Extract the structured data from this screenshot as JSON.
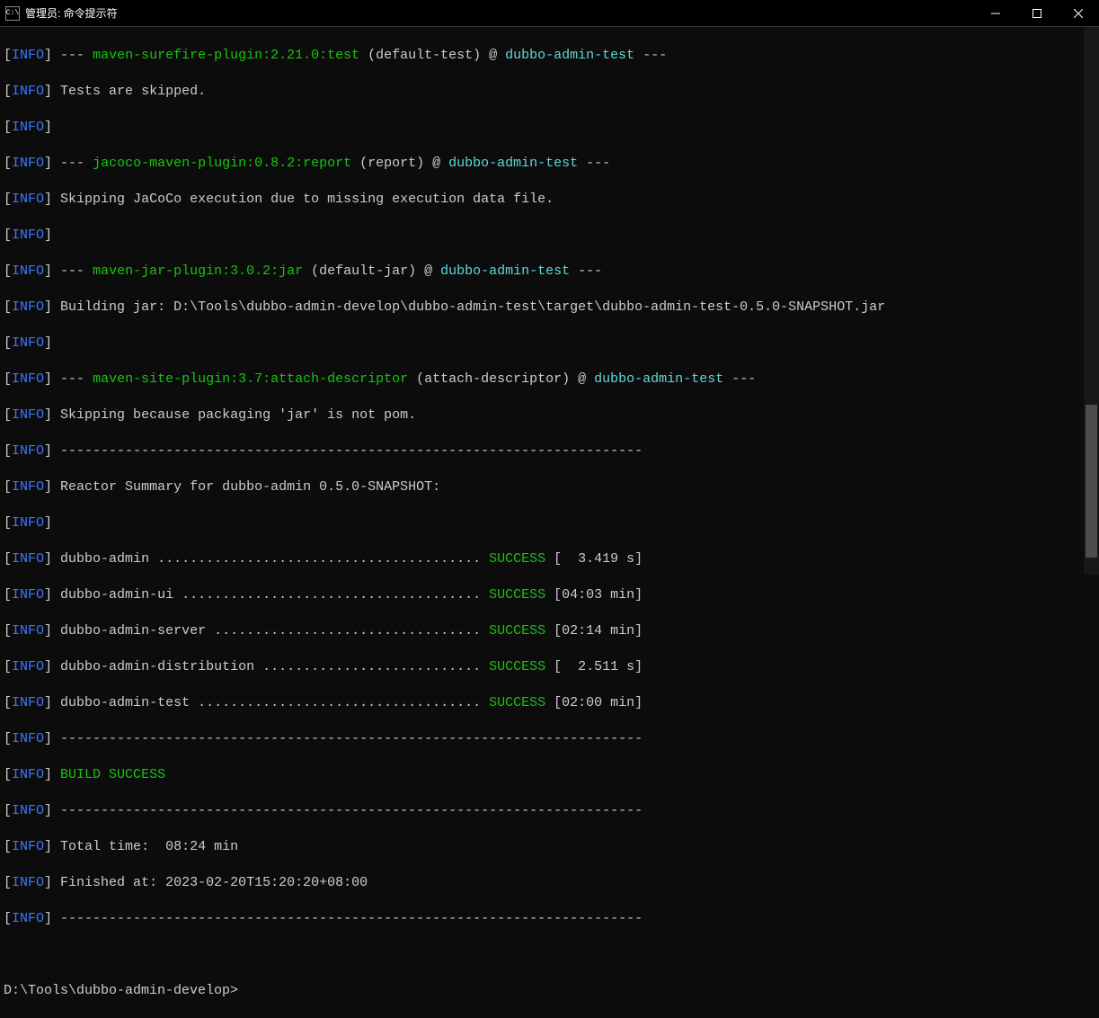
{
  "window": {
    "icon_text": "C:\\",
    "title": "管理员: 命令提示符"
  },
  "tag": {
    "bracket_open": "[",
    "bracket_close": "]",
    "info": "INFO"
  },
  "lines": {
    "l1": {
      "seg1": " --- ",
      "seg2": "maven-surefire-plugin:2.21.0:test",
      "seg3": " (default-test) @ ",
      "seg4": "dubbo-admin-test",
      "seg5": " ---"
    },
    "l2": " Tests are skipped.",
    "l3": "",
    "l4": {
      "seg1": " --- ",
      "seg2": "jacoco-maven-plugin:0.8.2:report",
      "seg3": " (report) @ ",
      "seg4": "dubbo-admin-test",
      "seg5": " ---"
    },
    "l5": " Skipping JaCoCo execution due to missing execution data file.",
    "l6": "",
    "l7": {
      "seg1": " --- ",
      "seg2": "maven-jar-plugin:3.0.2:jar",
      "seg3": " (default-jar) @ ",
      "seg4": "dubbo-admin-test",
      "seg5": " ---"
    },
    "l8": " Building jar: D:\\Tools\\dubbo-admin-develop\\dubbo-admin-test\\target\\dubbo-admin-test-0.5.0-SNAPSHOT.jar",
    "l9": "",
    "l10": {
      "seg1": " --- ",
      "seg2": "maven-site-plugin:3.7:attach-descriptor",
      "seg3": " (attach-descriptor) @ ",
      "seg4": "dubbo-admin-test",
      "seg5": " ---"
    },
    "l11": " Skipping because packaging 'jar' is not pom.",
    "l12": " ------------------------------------------------------------------------",
    "l13": " Reactor Summary for dubbo-admin 0.5.0-SNAPSHOT:",
    "l14": "",
    "r1": {
      "name": " dubbo-admin ........................................ ",
      "status": "SUCCESS",
      "time": " [  3.419 s]"
    },
    "r2": {
      "name": " dubbo-admin-ui ..................................... ",
      "status": "SUCCESS",
      "time": " [04:03 min]"
    },
    "r3": {
      "name": " dubbo-admin-server ................................. ",
      "status": "SUCCESS",
      "time": " [02:14 min]"
    },
    "r4": {
      "name": " dubbo-admin-distribution ........................... ",
      "status": "SUCCESS",
      "time": " [  2.511 s]"
    },
    "r5": {
      "name": " dubbo-admin-test ................................... ",
      "status": "SUCCESS",
      "time": " [02:00 min]"
    },
    "l20": " ------------------------------------------------------------------------",
    "l21": " BUILD SUCCESS",
    "l22": " ------------------------------------------------------------------------",
    "l23": " Total time:  08:24 min",
    "l24": " Finished at: 2023-02-20T15:20:20+08:00",
    "l25": " ------------------------------------------------------------------------"
  },
  "prompt": "D:\\Tools\\dubbo-admin-develop>"
}
